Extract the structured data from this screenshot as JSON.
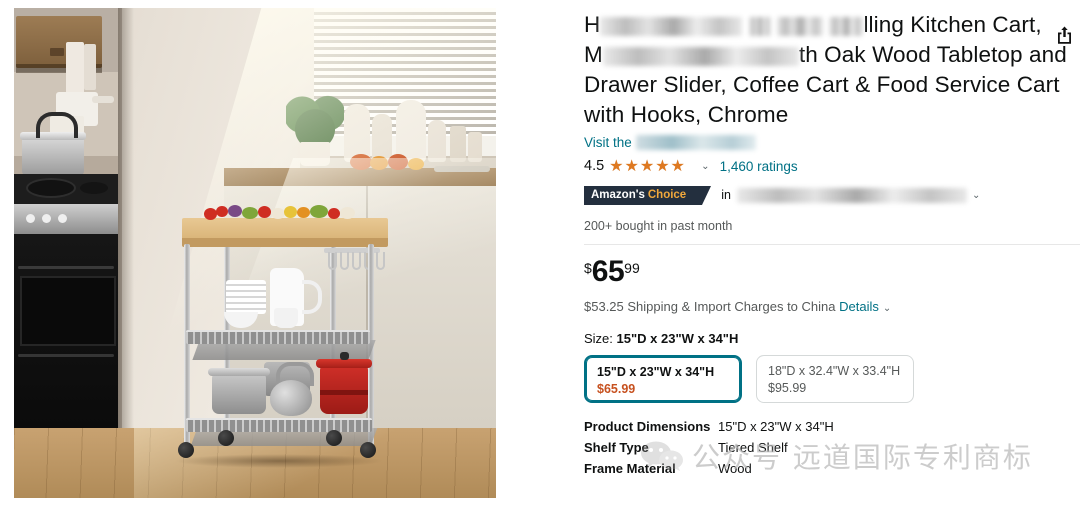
{
  "product_image": {
    "alt": "rolling kitchen cart with oak wood tabletop in a sunlit kitchen",
    "scene": "kitchen with stove, window blinds, plants and vegetables"
  },
  "share": {
    "icon": "share-icon"
  },
  "title": {
    "line1_start": "H",
    "line1_end": "lling Kitchen Cart,",
    "line2_start": "M",
    "line2_end": "th Oak Wood Tabletop and",
    "line3": "Drawer Slider, Coffee Cart & Food Service Cart",
    "line4": "with Hooks, Chrome"
  },
  "store": {
    "prefix": "Visit the",
    "name_redacted": true
  },
  "rating": {
    "value": "4.5",
    "stars_filled_pct": 90,
    "star_glyphs": "★★★★★",
    "chevron": "⌄",
    "count_label": "1,460 ratings"
  },
  "badge": {
    "amazon_word": "Amazon's",
    "choice_word": "Choice",
    "in_word": "in",
    "category_redacted": true,
    "chevron": "⌄"
  },
  "bought": "200+ bought in past month",
  "price": {
    "currency": "$",
    "whole": "65",
    "fraction": "99",
    "shipping_text": "$53.25 Shipping & Import Charges to China",
    "details_link": "Details",
    "details_chevron": "⌄"
  },
  "size": {
    "label": "Size:",
    "selected_value": "15\"D x 23\"W x 34\"H",
    "options": [
      {
        "name": "15\"D x 23\"W x 34\"H",
        "price": "$65.99",
        "selected": true
      },
      {
        "name": "18\"D x 32.4\"W x 33.4\"H",
        "price": "$95.99",
        "selected": false
      }
    ]
  },
  "details": {
    "rows": [
      {
        "key": "Product Dimensions",
        "value": "15\"D x 23\"W x 34\"H"
      },
      {
        "key": "Shelf Type",
        "value": "Tiered Shelf"
      },
      {
        "key": "Frame Material",
        "value": "Wood"
      }
    ]
  },
  "watermark": {
    "text": "公众号 远道国际专利商标",
    "logo": "wechat-logo"
  },
  "colors": {
    "link": "#007185",
    "price_accent": "#c7511f",
    "star": "#de7921",
    "badge_bg": "#232f3e",
    "badge_choice": "#f0a83c",
    "text": "#0f1111",
    "muted": "#565959"
  }
}
